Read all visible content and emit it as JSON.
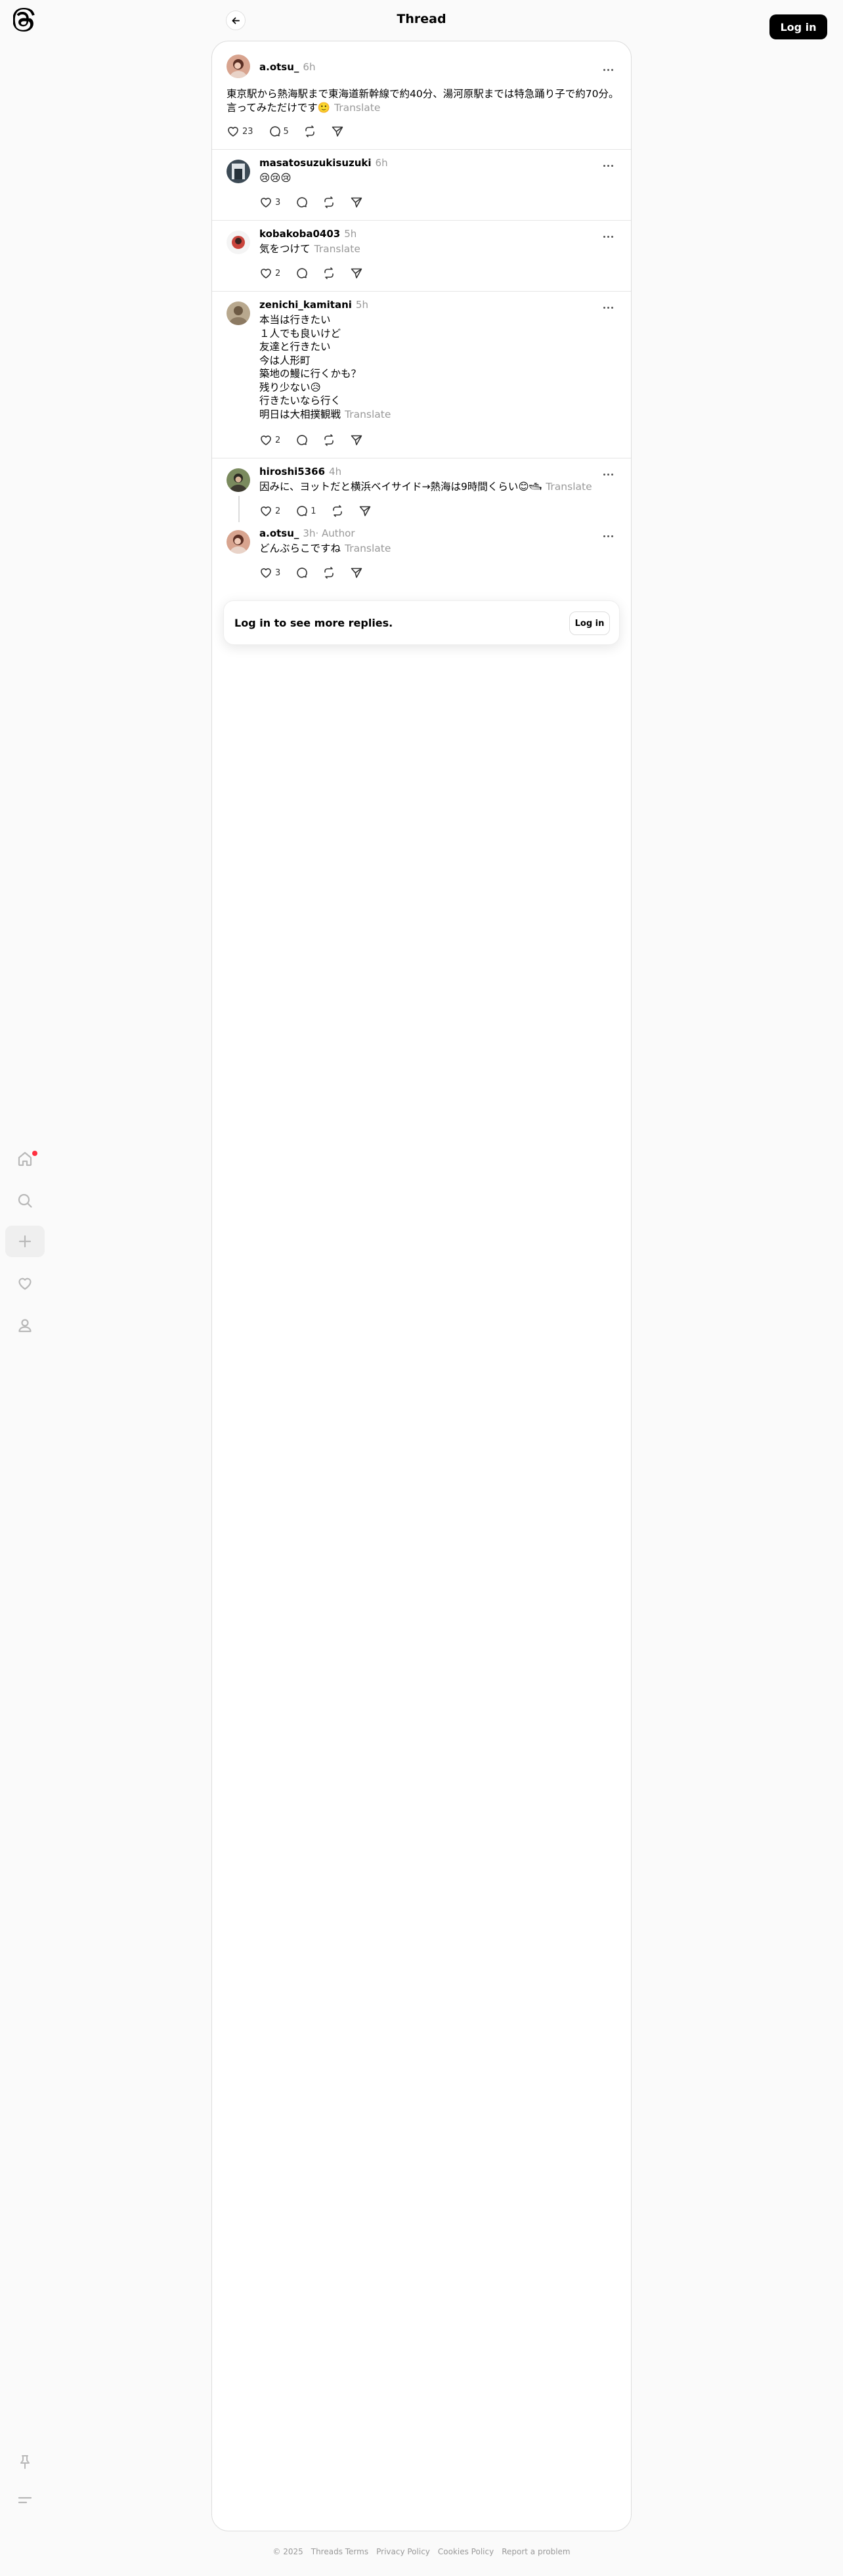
{
  "header": {
    "title": "Thread",
    "login_label": "Log in"
  },
  "nav_icons": [
    "threads-logo-icon",
    "home-icon",
    "search-icon",
    "plus-icon",
    "heart-icon",
    "profile-icon",
    "pin-icon",
    "menu-icon"
  ],
  "posts": [
    {
      "username": "a.otsu_",
      "time": "6h",
      "text": "東京駅から熱海駅まで東海道新幹線で約40分、湯河原駅までは特急踊り子で約70分。\n言ってみただけです🙂",
      "translate": "Translate",
      "likes": "23",
      "replies": "5"
    },
    {
      "username": "masatosuzukisuzuki",
      "time": "6h",
      "text": "😢😢😢",
      "likes": "3"
    },
    {
      "username": "kobakoba0403",
      "time": "5h",
      "text": "気をつけて",
      "translate": "Translate",
      "likes": "2"
    },
    {
      "username": "zenichi_kamitani",
      "time": "5h",
      "text": "本当は行きたい\n１人でも良いけど\n友達と行きたい\n今は人形町\n築地の鰻に行くかも？\n残り少ない😥\n行きたいなら行く\n明日は大相撲観戦",
      "translate": "Translate",
      "likes": "2"
    },
    {
      "username": "hiroshi5366",
      "time": "4h",
      "text": "因みに、ヨットだと横浜ベイサイド→熱海は9時間くらい😊🛥",
      "translate": "Translate",
      "likes": "2",
      "replies": "1"
    },
    {
      "username": "a.otsu_",
      "time": "3h",
      "author": "· Author",
      "text": "どんぶらこですね",
      "translate": "Translate",
      "likes": "3"
    }
  ],
  "login_prompt": {
    "text": "Log in to see more replies.",
    "button": "Log in"
  },
  "footer": {
    "copyright": "© 2025",
    "links": [
      "Threads Terms",
      "Privacy Policy",
      "Cookies Policy",
      "Report a problem"
    ]
  },
  "colors": {
    "notification_dot": "#ff3040",
    "muted_text": "#999999"
  }
}
